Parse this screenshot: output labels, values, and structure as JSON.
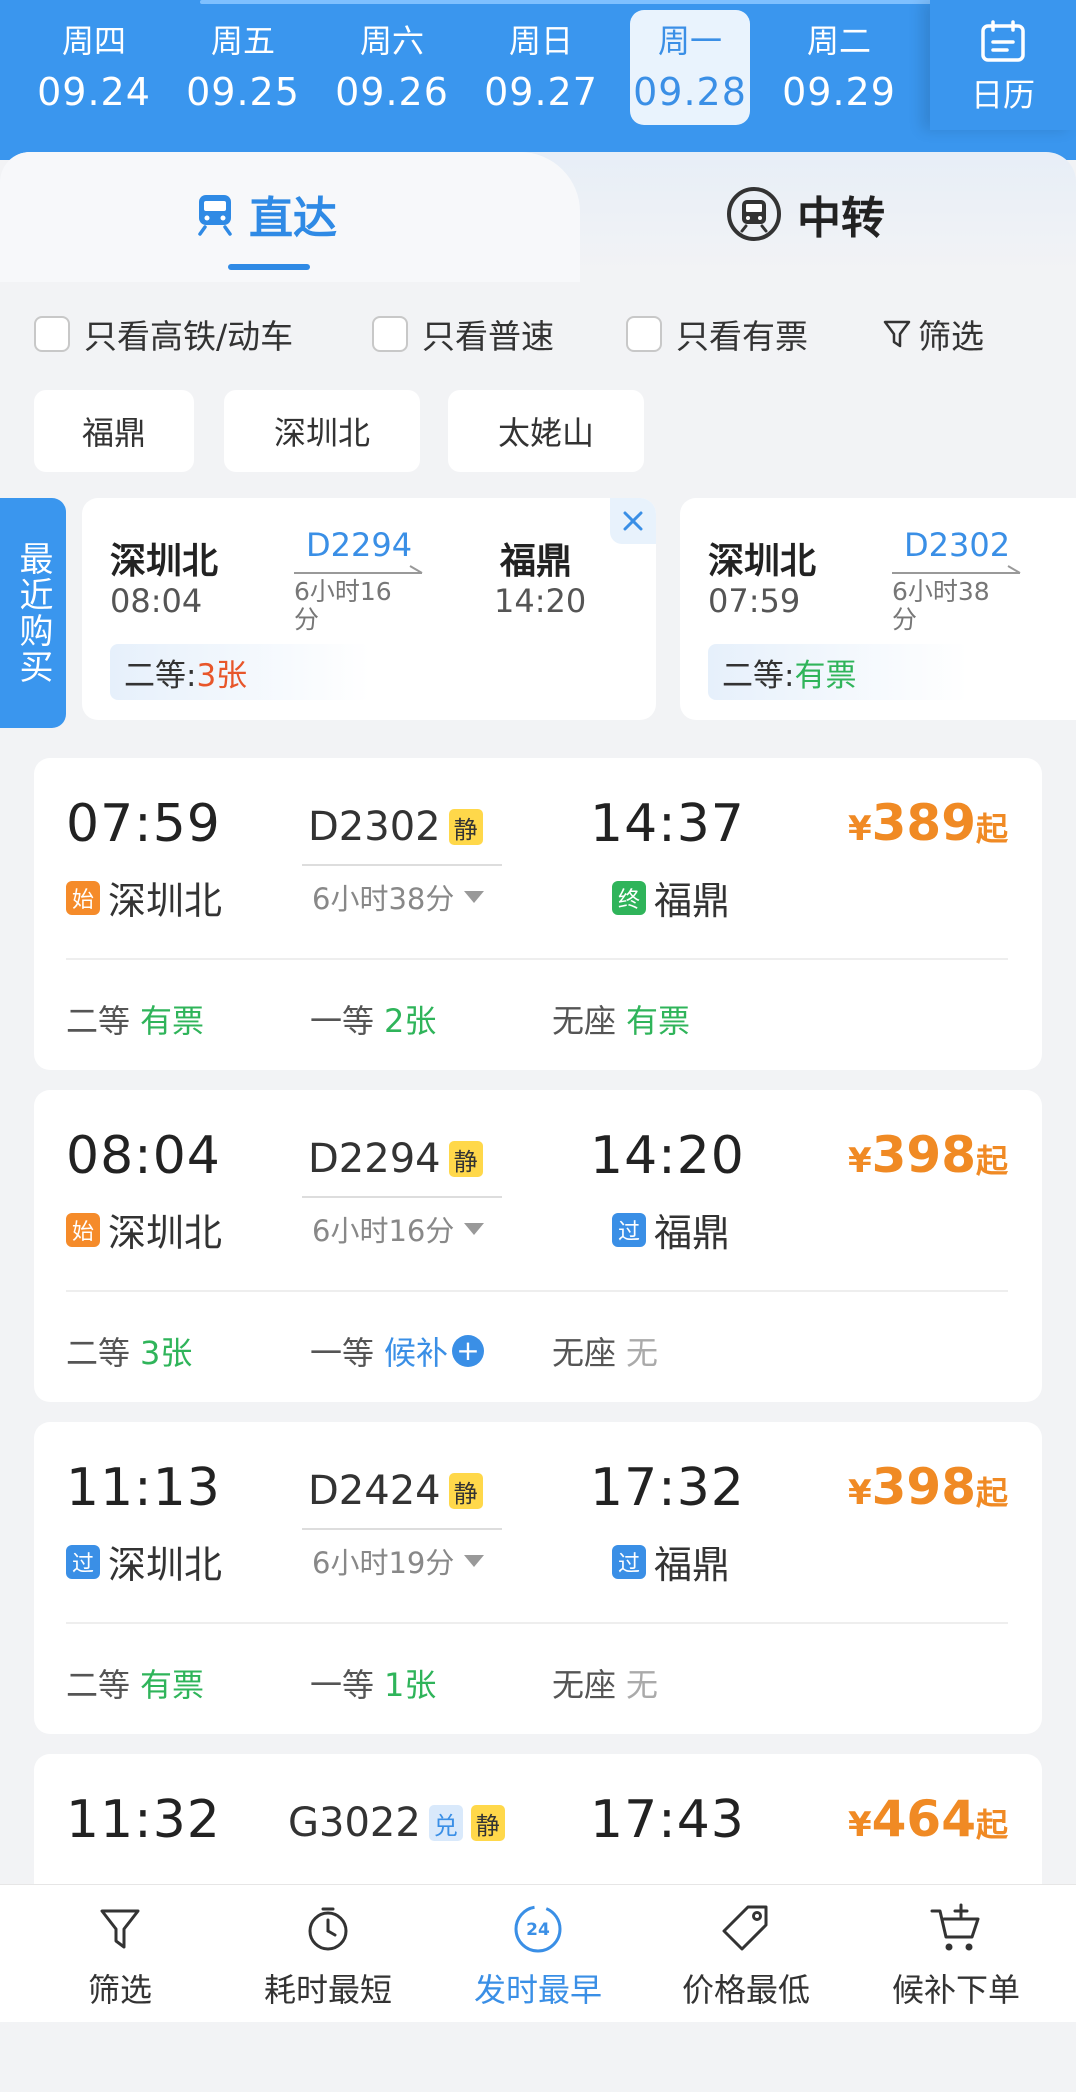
{
  "dates": [
    {
      "week": "周四",
      "date": "09.24"
    },
    {
      "week": "周五",
      "date": "09.25"
    },
    {
      "week": "周六",
      "date": "09.26"
    },
    {
      "week": "周日",
      "date": "09.27"
    },
    {
      "week": "周一",
      "date": "09.28"
    },
    {
      "week": "周二",
      "date": "09.29"
    }
  ],
  "calendar_label": "日历",
  "tabs": {
    "direct": "直达",
    "transfer": "中转"
  },
  "filters": {
    "highspeed": "只看高铁/动车",
    "normal": "只看普速",
    "available": "只看有票",
    "screen": "筛选"
  },
  "stations": [
    "福鼎",
    "深圳北",
    "太姥山"
  ],
  "recent": {
    "tag": "最近购买",
    "cards": [
      {
        "from": "深圳北",
        "from_time": "08:04",
        "train": "D2294",
        "duration": "6小时16分",
        "to": "福鼎",
        "to_time": "14:20",
        "seat_class": "二等:",
        "seat_value": "3张"
      },
      {
        "from": "深圳北",
        "from_time": "07:59",
        "train": "D2302",
        "duration": "6小时38分",
        "seat_class": "二等:",
        "seat_value": "有票"
      }
    ]
  },
  "trains": [
    {
      "dep_time": "07:59",
      "dep_badge": "始",
      "dep_station": "深圳北",
      "train_no": "D2302",
      "tags": [
        "静"
      ],
      "duration": "6小时38分",
      "arr_time": "14:37",
      "arr_badge": "终",
      "arr_station": "福鼎",
      "price_symbol": "¥",
      "price": "389",
      "price_suffix": "起",
      "seats": [
        {
          "class": "二等",
          "value": "有票"
        },
        {
          "class": "一等",
          "value": "2张"
        },
        {
          "class": "无座",
          "value": "有票"
        }
      ]
    },
    {
      "dep_time": "08:04",
      "dep_badge": "始",
      "dep_station": "深圳北",
      "train_no": "D2294",
      "tags": [
        "静"
      ],
      "duration": "6小时16分",
      "arr_time": "14:20",
      "arr_badge": "过",
      "arr_station": "福鼎",
      "price_symbol": "¥",
      "price": "398",
      "price_suffix": "起",
      "seats": [
        {
          "class": "二等",
          "value": "3张"
        },
        {
          "class": "一等",
          "value": "候补"
        },
        {
          "class": "无座",
          "value": "无"
        }
      ]
    },
    {
      "dep_time": "11:13",
      "dep_badge": "过",
      "dep_station": "深圳北",
      "train_no": "D2424",
      "tags": [
        "静"
      ],
      "duration": "6小时19分",
      "arr_time": "17:32",
      "arr_badge": "过",
      "arr_station": "福鼎",
      "price_symbol": "¥",
      "price": "398",
      "price_suffix": "起",
      "seats": [
        {
          "class": "二等",
          "value": "有票"
        },
        {
          "class": "一等",
          "value": "1张"
        },
        {
          "class": "无座",
          "value": "无"
        }
      ]
    },
    {
      "dep_time": "11:32",
      "train_no": "G3022",
      "tags": [
        "兑",
        "静"
      ],
      "arr_time": "17:43",
      "price_symbol": "¥",
      "price": "464",
      "price_suffix": "起"
    }
  ],
  "bottom_nav": {
    "filter": "筛选",
    "shortest": "耗时最短",
    "earliest": "发时最早",
    "earliest_icon_text": "24",
    "cheapest": "价格最低",
    "waitlist": "候补下单"
  },
  "colors": {
    "brand_blue": "#3a96ee",
    "price_orange": "#f08a24",
    "available_green": "#2fb45a",
    "limited_red": "#e8562a"
  }
}
